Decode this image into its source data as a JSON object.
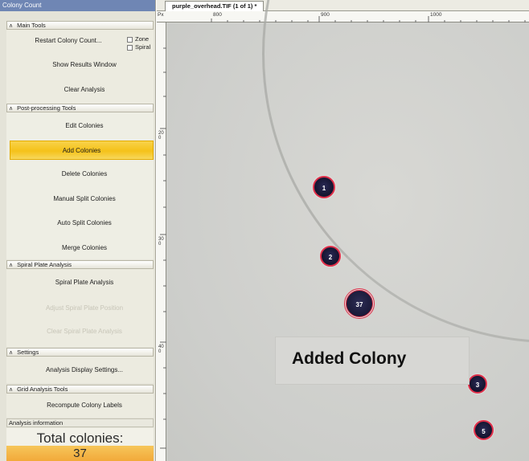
{
  "panel": {
    "title": "Colony Count",
    "main_tools": {
      "header": "Main Tools",
      "restart_label": "Restart Colony Count...",
      "zone_label": "Zone",
      "spiral_label": "Spiral",
      "results_label": "Show Results Window",
      "clear_label": "Clear Analysis"
    },
    "post_processing": {
      "header": "Post-processing Tools",
      "edit_label": "Edit Colonies",
      "add_label": "Add Colonies",
      "delete_label": "Delete Colonies",
      "manual_split_label": "Manual Split Colonies",
      "auto_split_label": "Auto Split Colonies",
      "merge_label": "Merge Colonies"
    },
    "spiral": {
      "header": "Spiral Plate Analysis",
      "analysis_label": "Spiral Plate Analysis",
      "disabled_1_label": "Adjust Spiral Plate Position",
      "disabled_2_label": "Clear Spiral Plate Analysis"
    },
    "settings": {
      "header": "Settings",
      "display_label": "Analysis Display Settings..."
    },
    "grid": {
      "header": "Grid Analysis Tools",
      "recompute_label": "Recompute Colony Labels"
    },
    "info": {
      "header": "Analysis information",
      "total_label": "Total colonies:",
      "total_value": "37"
    }
  },
  "viewer": {
    "tab_label": "purple_overhead.TIF (1 of 1) *",
    "ruler_unit": "Px",
    "ruler_h_labels": [
      "800",
      "900",
      "1000"
    ],
    "ruler_v_labels": [
      "200",
      "300",
      "400"
    ],
    "colonies": [
      "1",
      "2",
      "37",
      "3",
      "5"
    ],
    "callout_text": "Added Colony"
  },
  "colors": {
    "active_button": "#f5c21a",
    "colony_outline": "#e0304a",
    "titlebar": "#6f86b4"
  }
}
